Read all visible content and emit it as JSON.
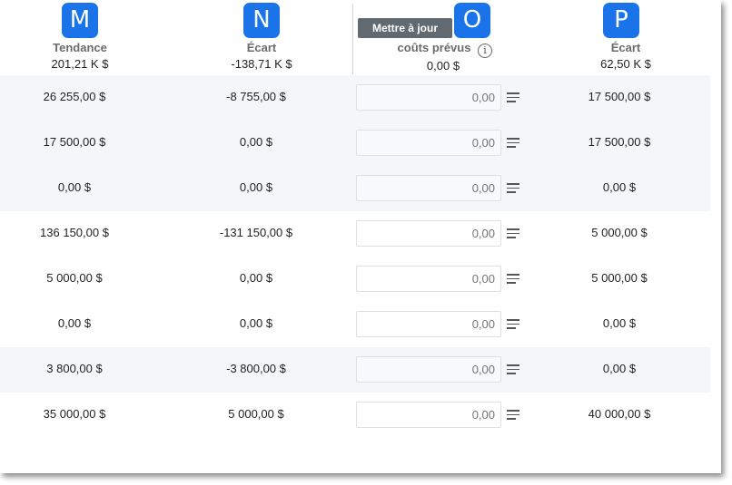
{
  "badges": {
    "m": "M",
    "n": "N",
    "o": "O",
    "p": "P"
  },
  "toolbar": {
    "update_label": "Mettre à jour"
  },
  "columns": {
    "tendance": {
      "title": "Tendance",
      "total": "201,21 K $"
    },
    "ecart1": {
      "title": "Écart",
      "total": "-138,71 K $"
    },
    "couts": {
      "title": "coûts prévus",
      "total": "0,00 $",
      "info_icon": "i"
    },
    "ecart2": {
      "title": "Écart",
      "total": "62,50 K $"
    }
  },
  "rows": [
    {
      "tendance": "26 255,00 $",
      "ecart1": "-8 755,00 $",
      "cost_placeholder": "0,00",
      "ecart2": "17 500,00 $",
      "shaded": true
    },
    {
      "tendance": "17 500,00 $",
      "ecart1": "0,00 $",
      "cost_placeholder": "0,00",
      "ecart2": "17 500,00 $",
      "shaded": true
    },
    {
      "tendance": "0,00 $",
      "ecart1": "0,00 $",
      "cost_placeholder": "0,00",
      "ecart2": "0,00 $",
      "shaded": true
    },
    {
      "tendance": "136 150,00 $",
      "ecart1": "-131 150,00 $",
      "cost_placeholder": "0,00",
      "ecart2": "5 000,00 $",
      "shaded": false
    },
    {
      "tendance": "5 000,00 $",
      "ecart1": "0,00 $",
      "cost_placeholder": "0,00",
      "ecart2": "5 000,00 $",
      "shaded": false
    },
    {
      "tendance": "0,00 $",
      "ecart1": "0,00 $",
      "cost_placeholder": "0,00",
      "ecart2": "0,00 $",
      "shaded": false
    },
    {
      "tendance": "3 800,00 $",
      "ecart1": "-3 800,00 $",
      "cost_placeholder": "0,00",
      "ecart2": "0,00 $",
      "shaded": true
    },
    {
      "tendance": "35 000,00 $",
      "ecart1": "5 000,00 $",
      "cost_placeholder": "0,00",
      "ecart2": "40 000,00 $",
      "shaded": false
    }
  ],
  "icons": {
    "row_menu": "menu-lines-icon",
    "info": "info-circle-icon"
  },
  "colors": {
    "badge": "#1a73e8",
    "button": "#616a70",
    "row_shade": "#f4f6f8"
  }
}
